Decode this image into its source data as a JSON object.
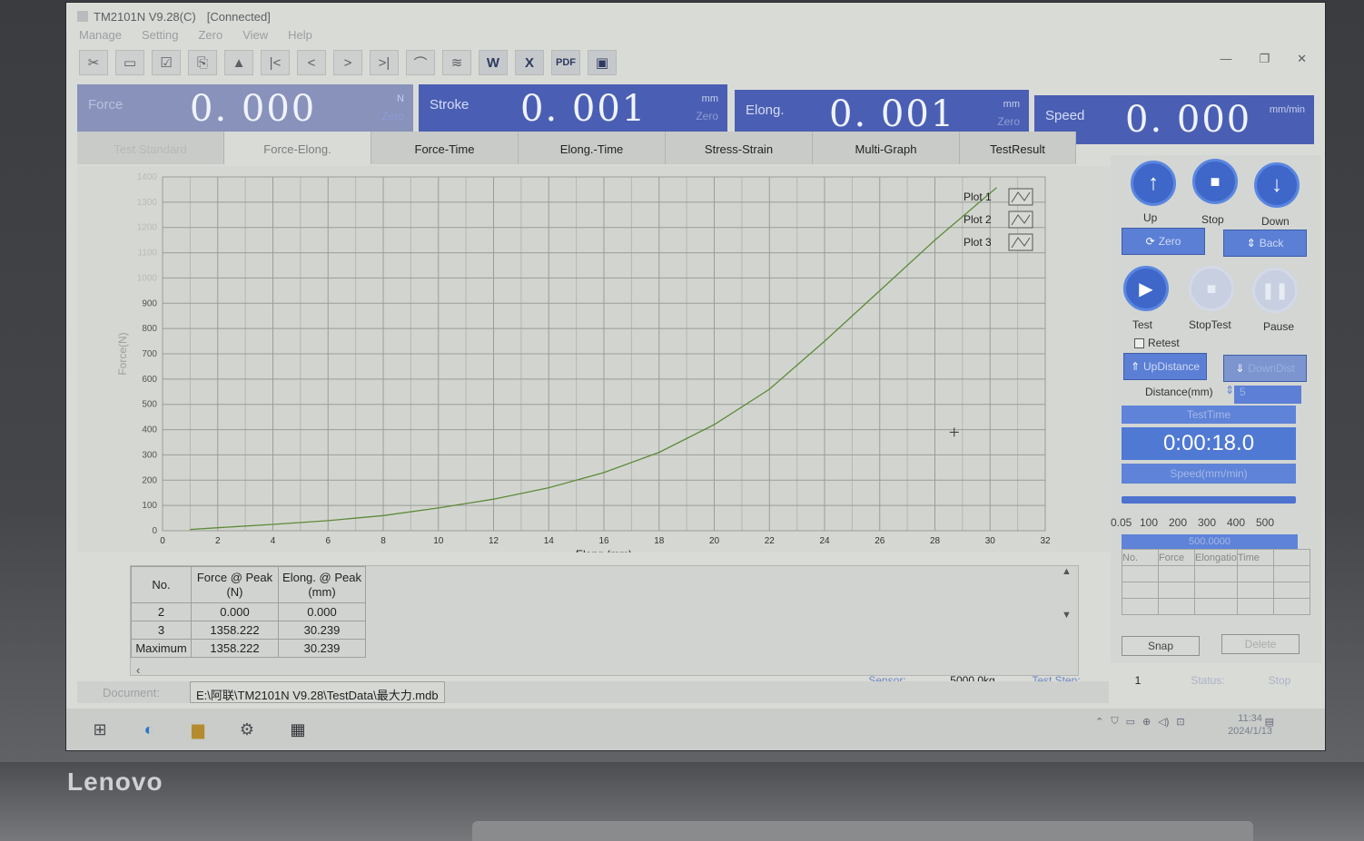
{
  "window": {
    "title": "TM2101N V9.28(C)",
    "connection": "[Connected]"
  },
  "menu": [
    "Manage",
    "Setting",
    "Zero",
    "View",
    "Help"
  ],
  "toolbar": {
    "buttons": [
      "open-icon",
      "save-icon",
      "settings-icon",
      "copy-icon",
      "sample-icon",
      "first-icon",
      "prev-icon",
      "next-icon",
      "last-icon",
      "curve-icon",
      "multi-curve-icon",
      "word-icon",
      "excel-icon",
      "pdf-icon",
      "screen-icon"
    ],
    "pdf_label": "PDF",
    "word_label": "W",
    "excel_label": "X"
  },
  "readouts": {
    "force": {
      "label": "Force",
      "value": "0. 000",
      "unit": "N",
      "zero": "Zero"
    },
    "stroke": {
      "label": "Stroke",
      "value": "0. 001",
      "unit": "mm",
      "zero": "Zero"
    },
    "elong": {
      "label": "Elong.",
      "value": "0. 001",
      "unit": "mm",
      "zero": "Zero"
    },
    "speed": {
      "label": "Speed",
      "value": "0. 000",
      "unit": "mm/min"
    }
  },
  "tabs": [
    "Test Standard",
    "Force-Elong.",
    "Force-Time",
    "Elong.-Time",
    "Stress-Strain",
    "Multi-Graph",
    "TestResult"
  ],
  "active_tab": "Force-Elong.",
  "chart_data": {
    "type": "line",
    "xlabel": "Elong.(mm)",
    "ylabel": "Force(N)",
    "xlim": [
      0,
      32
    ],
    "ylim": [
      0,
      1400
    ],
    "x_ticks": [
      0,
      2,
      4,
      6,
      8,
      10,
      12,
      14,
      16,
      18,
      20,
      22,
      24,
      26,
      28,
      30,
      32
    ],
    "y_ticks": [
      0,
      100,
      200,
      300,
      400,
      500,
      600,
      700,
      800,
      900,
      1000,
      1100,
      1200,
      1300,
      1400
    ],
    "grid": true,
    "legend_position": "top-right",
    "legend": [
      "Plot 1",
      "Plot 2",
      "Plot 3"
    ],
    "series": [
      {
        "color": "#5d8a3a",
        "x": [
          1,
          2,
          4,
          6,
          8,
          10,
          12,
          14,
          16,
          18,
          20,
          22,
          24,
          26,
          28,
          30.239
        ],
        "y": [
          5,
          12,
          25,
          40,
          60,
          90,
          125,
          170,
          230,
          310,
          420,
          560,
          750,
          950,
          1150,
          1358
        ]
      }
    ]
  },
  "results": {
    "headers": [
      [
        "No.",
        ""
      ],
      [
        "Force @ Peak",
        "(N)"
      ],
      [
        "Elong. @ Peak",
        "(mm)"
      ]
    ],
    "rows": [
      [
        "2",
        "0.000",
        "0.000"
      ],
      [
        "3",
        "1358.222",
        "30.239"
      ],
      [
        "Maximum",
        "1358.222",
        "30.239"
      ]
    ]
  },
  "controls": {
    "up": "Up",
    "stop": "Stop",
    "down": "Down",
    "zero_btn": "Zero",
    "back_btn": "Back",
    "test": "Test",
    "stoptest": "StopTest",
    "pause": "Pause",
    "retest": "Retest",
    "updistance": "UpDistance",
    "downdistance": "DownDist",
    "distance_label": "Distance(mm)",
    "distance_value": "5",
    "testtime_label": "TestTime",
    "testtime_value": "0:00:18.0",
    "speed_label": "Speed(mm/min)",
    "speed_scale": [
      "0.05",
      "100",
      "200",
      "300",
      "400",
      "500"
    ],
    "speed_value": "500.0000",
    "mini_headers": [
      "No.",
      "Force",
      "Elongatio",
      "Time"
    ],
    "snap": "Snap",
    "delete": "Delete"
  },
  "status": {
    "sensor_label": "Sensor:",
    "sensor_value": "5000.0kg",
    "teststep_label": "Test Step:",
    "teststep_value": "1",
    "status_label": "Status:",
    "status_value": "Stop"
  },
  "document": {
    "label": "Document:",
    "path": "E:\\阿联\\TM2101N V9.28\\TestData\\最大力.mdb"
  },
  "taskbar": {
    "time": "11:34",
    "date": "2024/1/13"
  },
  "brand": "Lenovo"
}
